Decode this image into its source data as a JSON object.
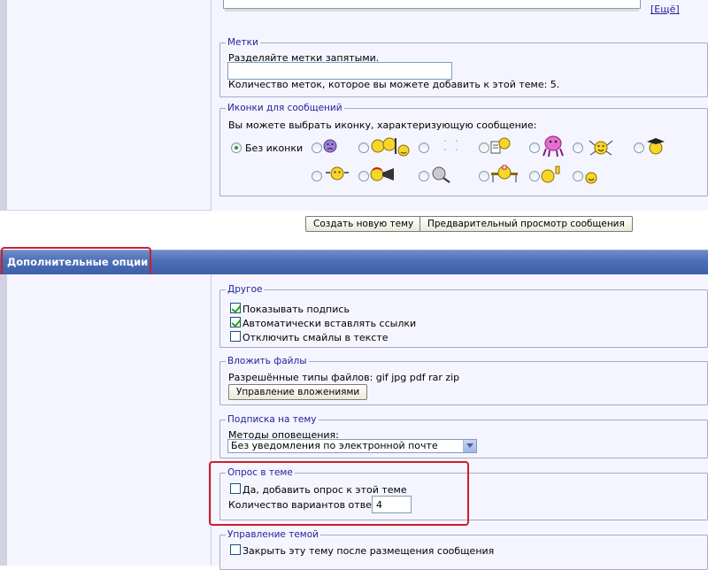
{
  "top": {
    "more_link": "Ещё",
    "tags": {
      "legend": "Метки",
      "hint": "Разделяйте метки запятыми.",
      "input_value": "",
      "count_text": "Количество меток, которое вы можете добавить к этой теме: 5."
    },
    "icons": {
      "legend": "Иконки для сообщений",
      "hint": "Вы можете выбрать иконку, характеризующую сообщение:",
      "no_icon_label": "Без иконки",
      "selected": "no-icon",
      "options": [
        "sad",
        "cheers",
        "blank",
        "note-reader",
        "pink-monster",
        "dancing",
        "graduate",
        "crying",
        "megaphone",
        "magnifier",
        "nurse",
        "thumbs-up",
        "small-smile"
      ]
    },
    "buttons": {
      "create": "Создать новую тему",
      "preview": "Предварительный просмотр сообщения"
    }
  },
  "additional": {
    "title": "Дополнительные опции",
    "other": {
      "legend": "Другое",
      "show_signature": "Показывать подпись",
      "auto_links": "Автоматически вставлять ссылки",
      "disable_smilies": "Отключить смайлы в тексте",
      "show_signature_checked": true,
      "auto_links_checked": true,
      "disable_smilies_checked": false
    },
    "attach": {
      "legend": "Вложить файлы",
      "allowed": "Разрешённые типы файлов: gif jpg pdf rar zip",
      "manage_button": "Управление вложениями"
    },
    "subscribe": {
      "legend": "Подписка на тему",
      "method_label": "Методы оповещения:",
      "method_value": "Без уведомления по электронной почте"
    },
    "poll": {
      "legend": "Опрос в теме",
      "add_poll": "Да, добавить опрос к этой теме",
      "add_poll_checked": false,
      "options_label": "Количество вариантов ответов:",
      "options_value": "4"
    },
    "manage": {
      "legend": "Управление темой",
      "close_topic": "Закрыть эту тему после размещения сообщения",
      "close_topic_checked": false
    }
  },
  "colors": {
    "header": "#4b6eb6",
    "legend": "#22229c",
    "highlight": "#cc1f2a",
    "panel": "#f5f5ff"
  }
}
